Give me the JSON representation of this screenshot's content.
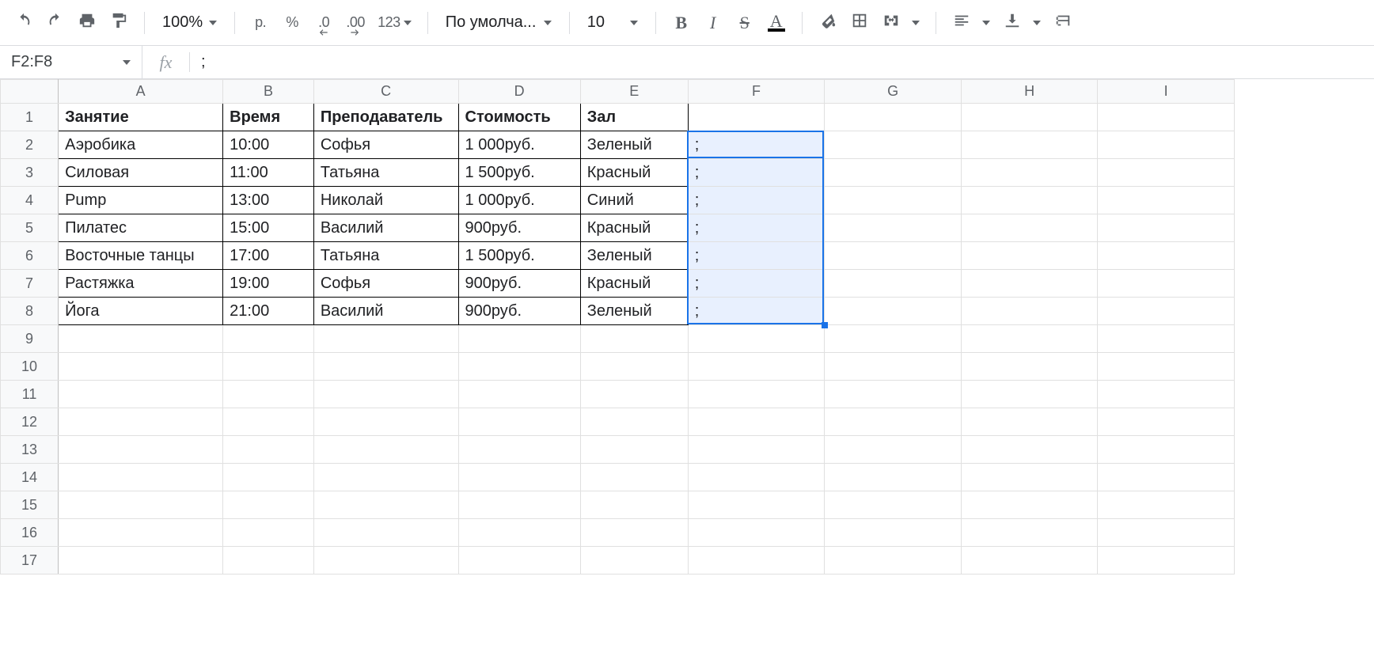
{
  "toolbar": {
    "zoom": "100%",
    "currency_label": "р.",
    "percent_label": "%",
    "dec_decrease": ".0",
    "dec_increase": ".00",
    "more_formats": "123",
    "font_name": "По умолча...",
    "font_size": "10"
  },
  "formula_bar": {
    "name_box": "F2:F8",
    "fx": "fx",
    "value": ";"
  },
  "columns": [
    "A",
    "B",
    "C",
    "D",
    "E",
    "F",
    "G",
    "H",
    "I"
  ],
  "row_count": 17,
  "headers": {
    "A": "Занятие",
    "B": "Время",
    "C": "Преподаватель",
    "D": "Стоимость",
    "E": "Зал"
  },
  "rows": [
    {
      "A": "Аэробика",
      "B": "10:00",
      "C": "Софья",
      "D": "1 000руб.",
      "E": "Зеленый",
      "F": ";"
    },
    {
      "A": "Силовая",
      "B": "11:00",
      "C": "Татьяна",
      "D": "1 500руб.",
      "E": "Красный",
      "F": ";"
    },
    {
      "A": "Pump",
      "B": "13:00",
      "C": "Николай",
      "D": "1 000руб.",
      "E": "Синий",
      "F": ";"
    },
    {
      "A": "Пилатес",
      "B": "15:00",
      "C": "Василий",
      "D": "900руб.",
      "E": "Красный",
      "F": ";"
    },
    {
      "A": "Восточные танцы",
      "B": "17:00",
      "C": "Татьяна",
      "D": "1 500руб.",
      "E": "Зеленый",
      "F": ";"
    },
    {
      "A": "Растяжка",
      "B": "19:00",
      "C": "Софья",
      "D": "900руб.",
      "E": "Красный",
      "F": ";"
    },
    {
      "A": "Йога",
      "B": "21:00",
      "C": "Василий",
      "D": "900руб.",
      "E": "Зеленый",
      "F": ";"
    }
  ],
  "selection": {
    "col": "F",
    "rowStart": 2,
    "rowEnd": 8
  }
}
